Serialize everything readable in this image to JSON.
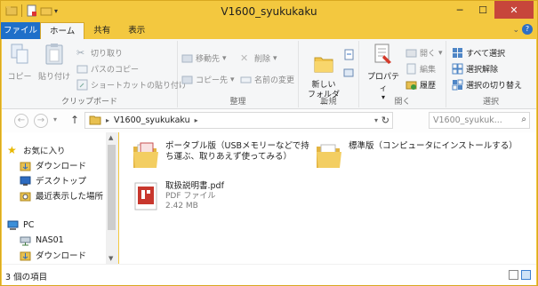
{
  "window": {
    "title": "V1600_syukukaku"
  },
  "ribbon_tabs": [
    "ファイル",
    "ホーム",
    "共有",
    "表示"
  ],
  "ribbon": {
    "clipboard": {
      "copy": "コピー",
      "paste": "貼り付け",
      "cut": "切り取り",
      "copy_path": "パスのコピー",
      "paste_shortcut": "ショートカットの貼り付け",
      "label": "クリップボード"
    },
    "organize": {
      "move_to": "移動先",
      "copy_to": "コピー先",
      "delete": "削除",
      "rename": "名前の変更",
      "label": "整理"
    },
    "new": {
      "new_folder": "新しい\nフォルダー",
      "label": "新規"
    },
    "open": {
      "properties": "プロパティ",
      "open": "開く",
      "edit": "編集",
      "history": "履歴",
      "label": "開く"
    },
    "select": {
      "select_all": "すべて選択",
      "select_none": "選択解除",
      "invert": "選択の切り替え",
      "label": "選択"
    }
  },
  "address": {
    "path": "V1600_syukukaku",
    "search_placeholder": "V1600_syukuk..."
  },
  "nav_pane": {
    "favorites": "お気に入り",
    "fav_items": [
      "ダウンロード",
      "デスクトップ",
      "最近表示した場所"
    ],
    "pc": "PC",
    "pc_items": [
      "NAS01",
      "ダウンロード"
    ]
  },
  "files": [
    {
      "name": "ポータブル版（USBメモリーなどで持ち運ぶ、取りあえず使ってみる）",
      "type": "folder",
      "icon": "folder-documents-icon"
    },
    {
      "name": "標準版（コンピュータにインストールする）",
      "type": "folder",
      "icon": "folder-icon"
    },
    {
      "name": "取扱説明書.pdf",
      "sub1": "PDF ファイル",
      "sub2": "2.42 MB",
      "type": "pdf",
      "icon": "pdf-icon"
    }
  ],
  "status": {
    "count": "3 個の項目"
  },
  "colors": {
    "frame": "#f3c83f",
    "file_tab": "#1e6fc9",
    "close": "#c7463b"
  }
}
